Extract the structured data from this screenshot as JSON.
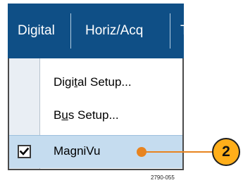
{
  "menubar": {
    "items": [
      {
        "label": "Digital"
      },
      {
        "label": "Horiz/Acq"
      },
      {
        "label": "T"
      }
    ]
  },
  "menu": {
    "items": [
      {
        "label_before": "Digi",
        "mnemonic": "t",
        "label_after": "al Setup...",
        "checked": false
      },
      {
        "label_before": "B",
        "mnemonic": "u",
        "label_after": "s Setup...",
        "checked": false
      },
      {
        "label_before": "MagniVu",
        "mnemonic": "",
        "label_after": "",
        "checked": true
      }
    ]
  },
  "callout": {
    "number": "2"
  },
  "figure_id": "2790-055",
  "colors": {
    "menubar_bg": "#0f4f86",
    "selected_item_bg": "#c5dcef",
    "callout_accent": "#e88420",
    "callout_fill": "#ffae1a"
  }
}
